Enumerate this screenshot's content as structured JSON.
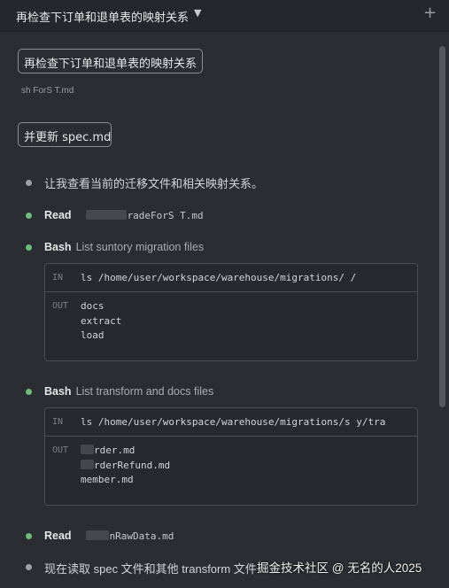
{
  "header": {
    "title": "再检查下订单和退单表的映射关系",
    "chevron_icon": "chevron-down-icon",
    "add_icon": "plus-icon"
  },
  "messages": {
    "user_1": "再检查下订单和退单表的映射关系",
    "attachment_name": "sh      ForS  T.md",
    "user_2": "并更新 spec.md"
  },
  "steps": [
    {
      "type": "text",
      "text": "让我查看当前的迁移文件和相关映射关系。"
    },
    {
      "type": "read",
      "keyword": "Read",
      "path": "radeForS  T.md"
    },
    {
      "type": "bash",
      "keyword": "Bash",
      "desc": "List suntory migration files",
      "in_label": "IN",
      "out_label": "OUT",
      "command": "ls /home/user/workspace/warehouse/migrations/          /",
      "output": [
        "docs",
        "extract",
        "load"
      ]
    },
    {
      "type": "bash",
      "keyword": "Bash",
      "desc": "List transform and docs files",
      "in_label": "IN",
      "out_label": "OUT",
      "command": "ls /home/user/workspace/warehouse/migrations/s       y/tra",
      "output": [
        "rder.md",
        "rderRefund.md",
        "member.md"
      ]
    },
    {
      "type": "read",
      "keyword": "Read",
      "path": "nRawData.md"
    },
    {
      "type": "text",
      "text": "现在读取 spec 文件和其他 transform 文件"
    }
  ],
  "watermark": "掘金技术社区 @ 无名的人2025",
  "colors": {
    "status_done": "#6dbb7f",
    "status_text": "#9ea1a6",
    "background": "#2a2d31"
  }
}
